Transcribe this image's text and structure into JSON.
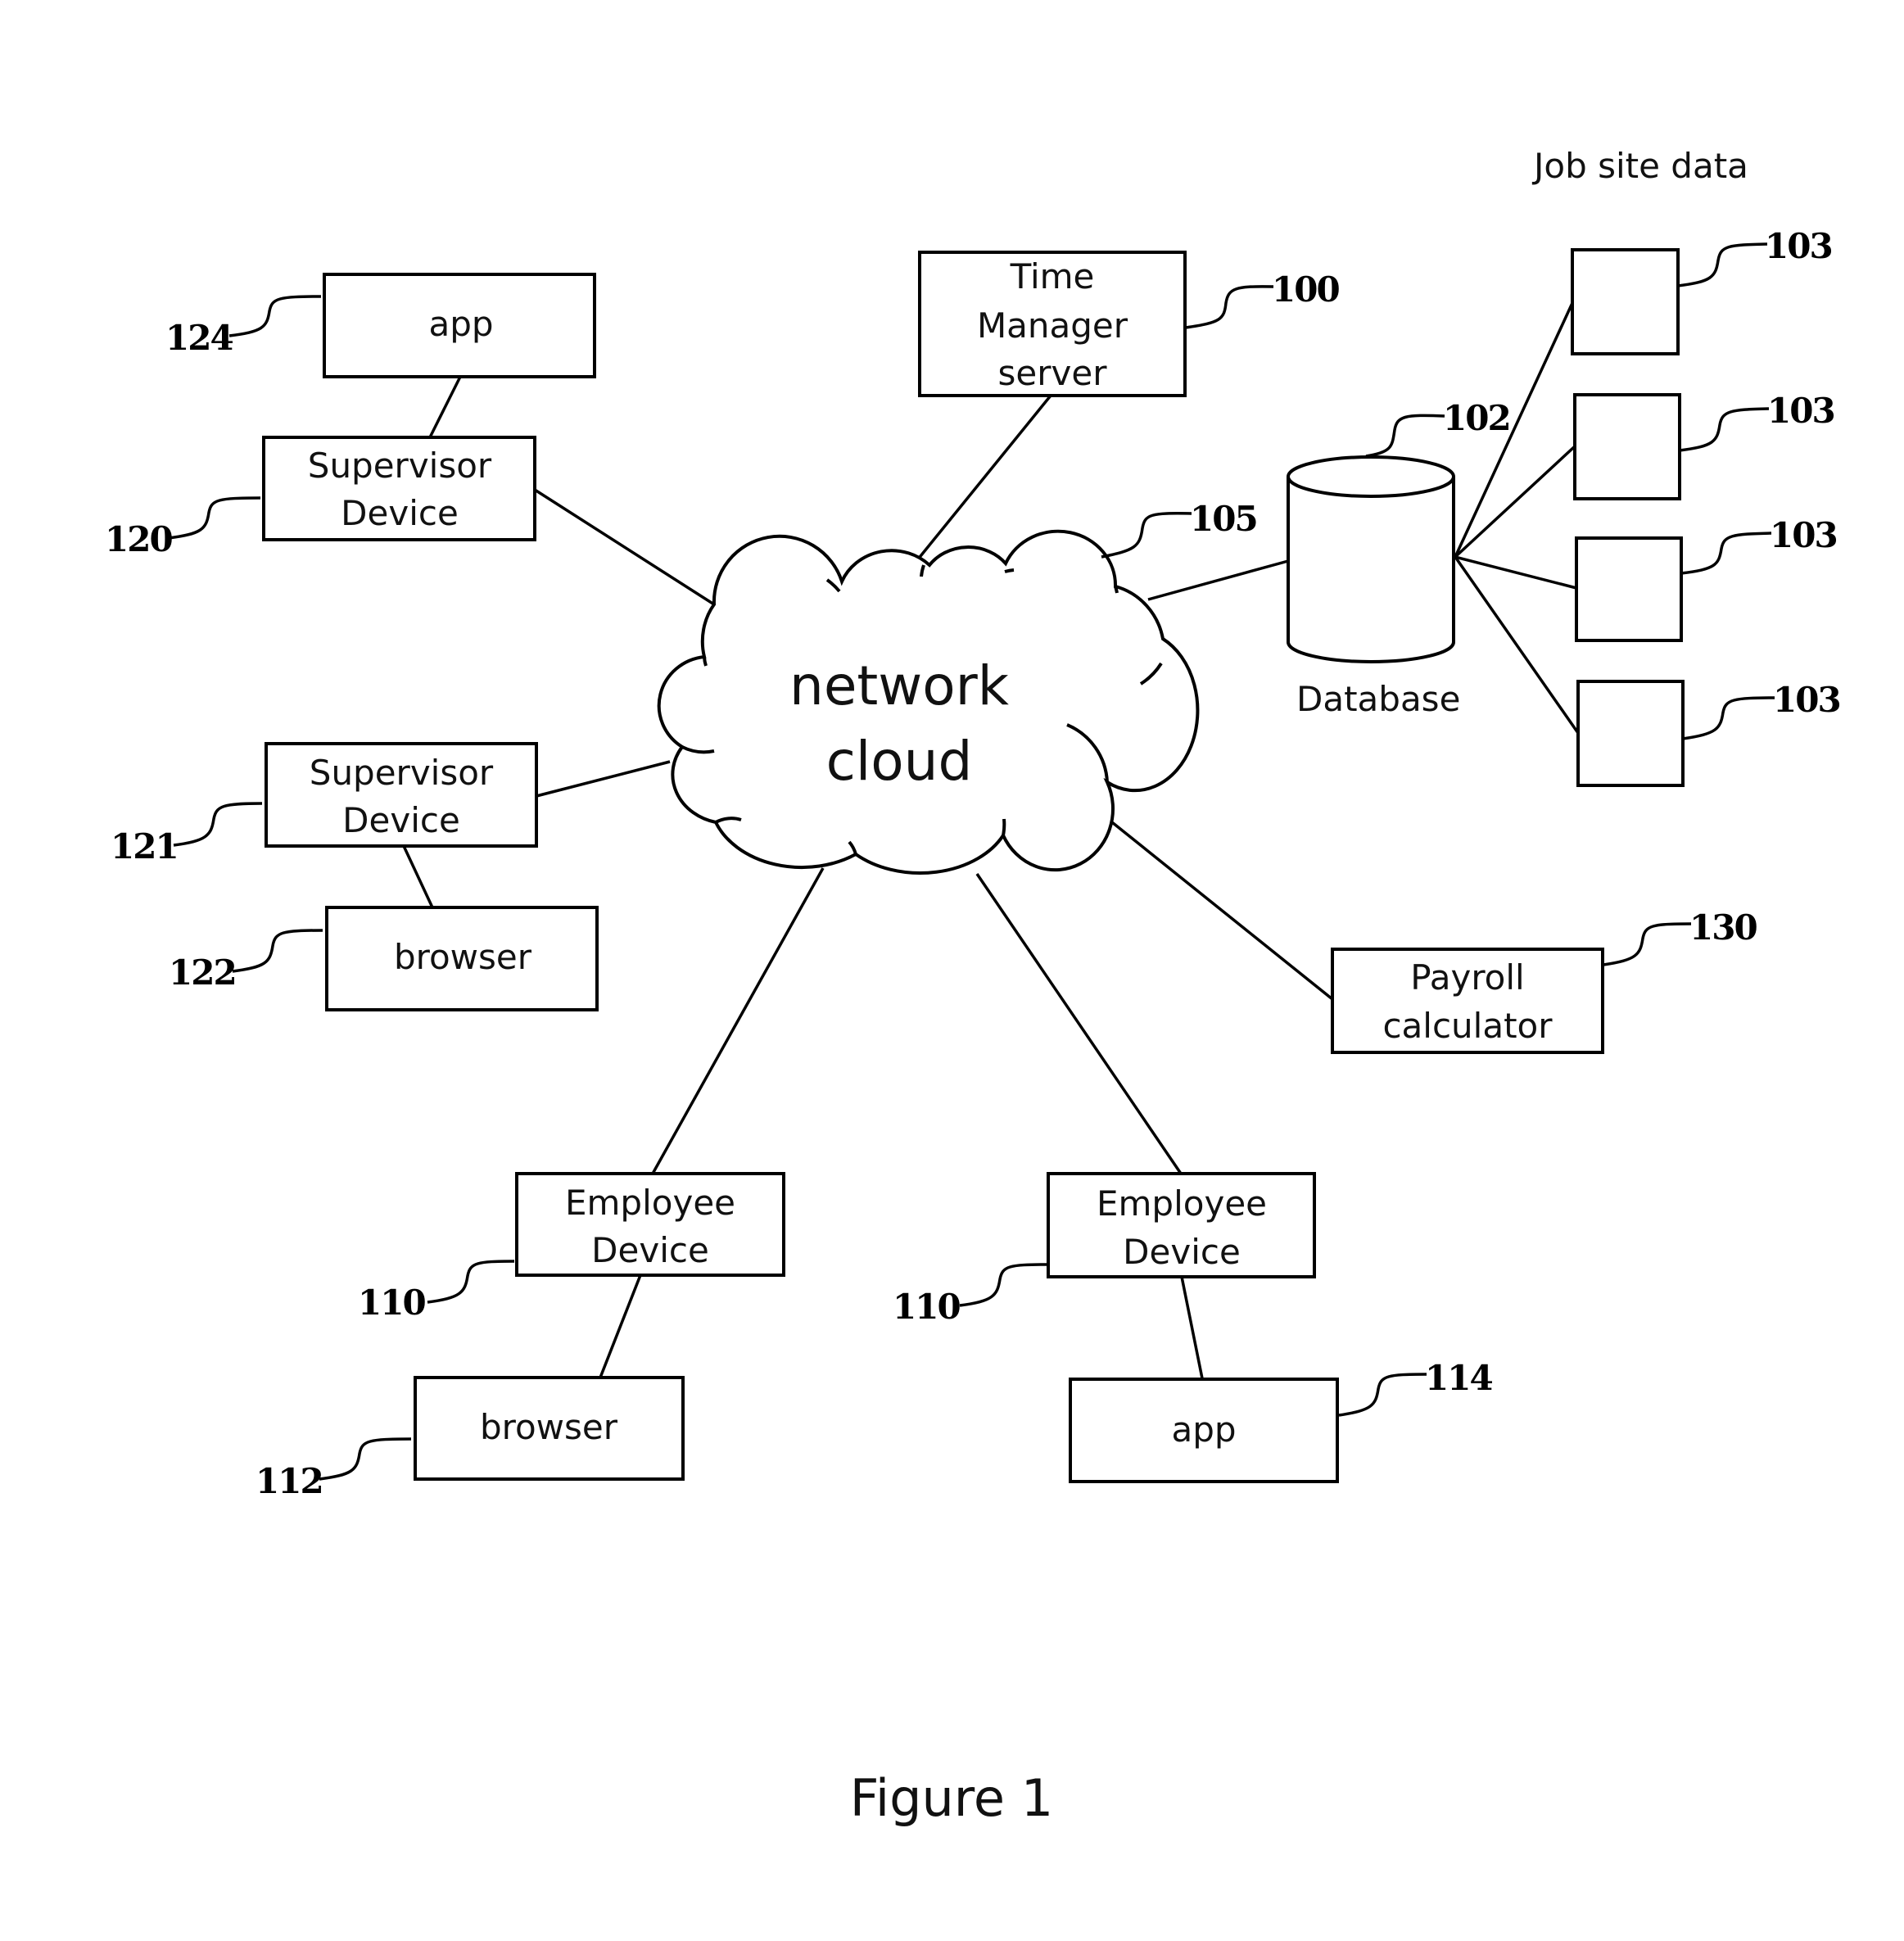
{
  "figure": {
    "caption": "Figure 1",
    "job_site_title": "Job site data"
  },
  "cloud": {
    "line1": "network",
    "line2": "cloud",
    "ref": "105"
  },
  "server": {
    "lines": [
      "Time",
      "Manager",
      "server"
    ],
    "ref": "100"
  },
  "database": {
    "label": "Database",
    "ref": "102"
  },
  "job_sites": [
    {
      "ref": "103"
    },
    {
      "ref": "103"
    },
    {
      "ref": "103"
    },
    {
      "ref": "103"
    }
  ],
  "supervisor_app": {
    "label": "app",
    "ref": "124"
  },
  "supervisor_device_1": {
    "lines": [
      "Supervisor",
      "Device"
    ],
    "ref": "120"
  },
  "supervisor_device_2": {
    "lines": [
      "Supervisor",
      "Device"
    ],
    "ref": "121"
  },
  "supervisor_browser": {
    "label": "browser",
    "ref": "122"
  },
  "employee_device_1": {
    "lines": [
      "Employee",
      "Device"
    ],
    "ref": "110"
  },
  "employee_browser": {
    "label": "browser",
    "ref": "112"
  },
  "employee_device_2": {
    "lines": [
      "Employee",
      "Device"
    ],
    "ref": "110"
  },
  "employee_app": {
    "label": "app",
    "ref": "114"
  },
  "payroll": {
    "lines": [
      "Payroll",
      "calculator"
    ],
    "ref": "130"
  }
}
